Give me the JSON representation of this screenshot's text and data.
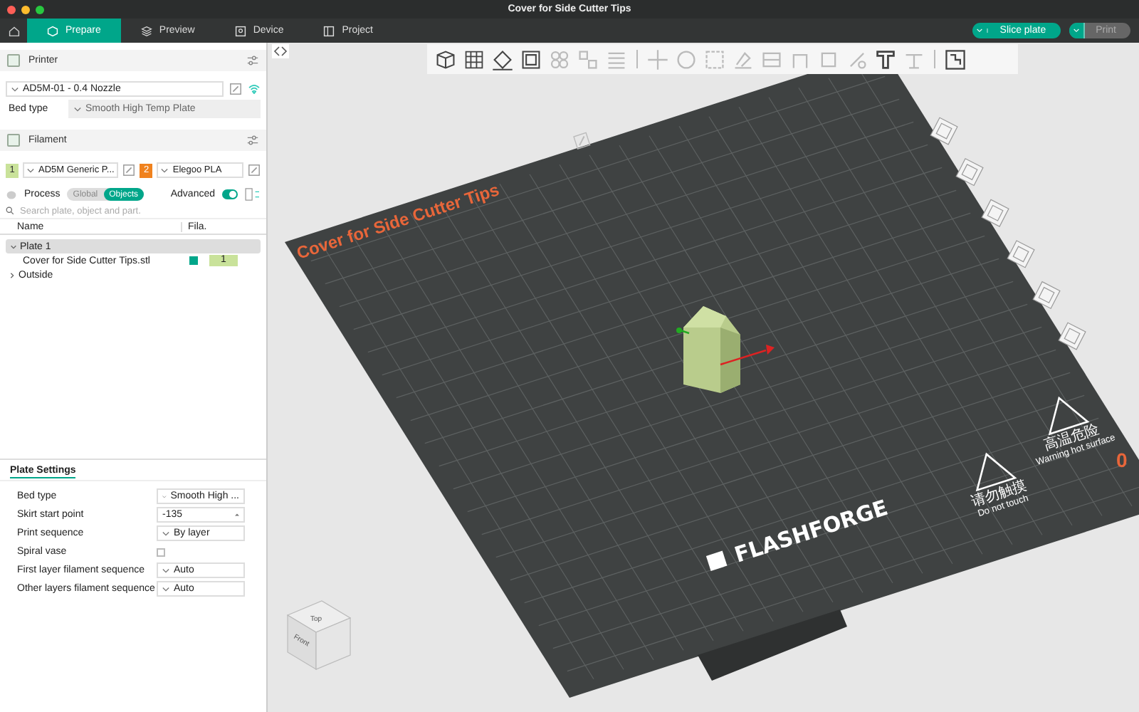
{
  "window": {
    "title": "Cover for Side Cutter Tips"
  },
  "tabs": [
    {
      "label": "Prepare",
      "selected": true,
      "kind": "prepare"
    },
    {
      "label": "Preview",
      "selected": false,
      "kind": "preview"
    },
    {
      "label": "Device",
      "selected": false,
      "kind": "device"
    },
    {
      "label": "Project",
      "selected": false,
      "kind": "project"
    }
  ],
  "actions": [
    {
      "label": "Slice plate",
      "disabled": false
    },
    {
      "label": "Print",
      "disabled": true
    }
  ],
  "printer": {
    "title": "Printer",
    "preset": "AD5M-01 - 0.4 Nozzle",
    "bed_label": "Bed type",
    "bed_value": "Smooth High Temp Plate"
  },
  "filament": {
    "title": "Filament",
    "items": [
      {
        "index": "1",
        "color": "#c9e29a",
        "name": "AD5M Generic P..."
      },
      {
        "index": "2",
        "color": "#f0821e",
        "name": "Elegoo PLA"
      }
    ]
  },
  "process": {
    "title": "Process",
    "modes": [
      {
        "label": "Global",
        "selected": false
      },
      {
        "label": "Objects",
        "selected": true
      }
    ],
    "advanced_label": "Advanced",
    "advanced": true
  },
  "objects": {
    "placeholder": "Search plate, object and part.",
    "columns": [
      "Name",
      "Fila."
    ],
    "tree": [
      {
        "label": "Plate 1",
        "expanded": true,
        "children": [
          {
            "label": "Cover for Side Cutter Tips.stl",
            "checked": true,
            "filament": "1"
          }
        ]
      },
      {
        "label": "Outside",
        "expanded": false
      }
    ]
  },
  "plate_settings": {
    "title": "Plate Settings",
    "rows": [
      {
        "label": "Bed type",
        "kind": "select",
        "value": "Smooth High ..."
      },
      {
        "label": "Skirt start point",
        "kind": "spin",
        "value": "-135"
      },
      {
        "label": "Print sequence",
        "kind": "select",
        "value": "By layer"
      },
      {
        "label": "Spiral vase",
        "kind": "checkbox",
        "checked": false
      },
      {
        "label": "First layer filament sequence",
        "kind": "select",
        "value": "Auto"
      },
      {
        "label": "Other layers filament sequence",
        "kind": "select",
        "value": "Auto"
      }
    ]
  },
  "viewport": {
    "plate_label": "Cover for Side Cutter Tips",
    "logo": "FLASHFORGE",
    "warnings": [
      {
        "cn": "请勿触摸",
        "en": "Do not touch"
      },
      {
        "cn": "高温危险",
        "en": "Warning hot surface"
      }
    ],
    "edge_label": "0",
    "view_cube": {
      "top": "Top",
      "front": "Front"
    }
  }
}
